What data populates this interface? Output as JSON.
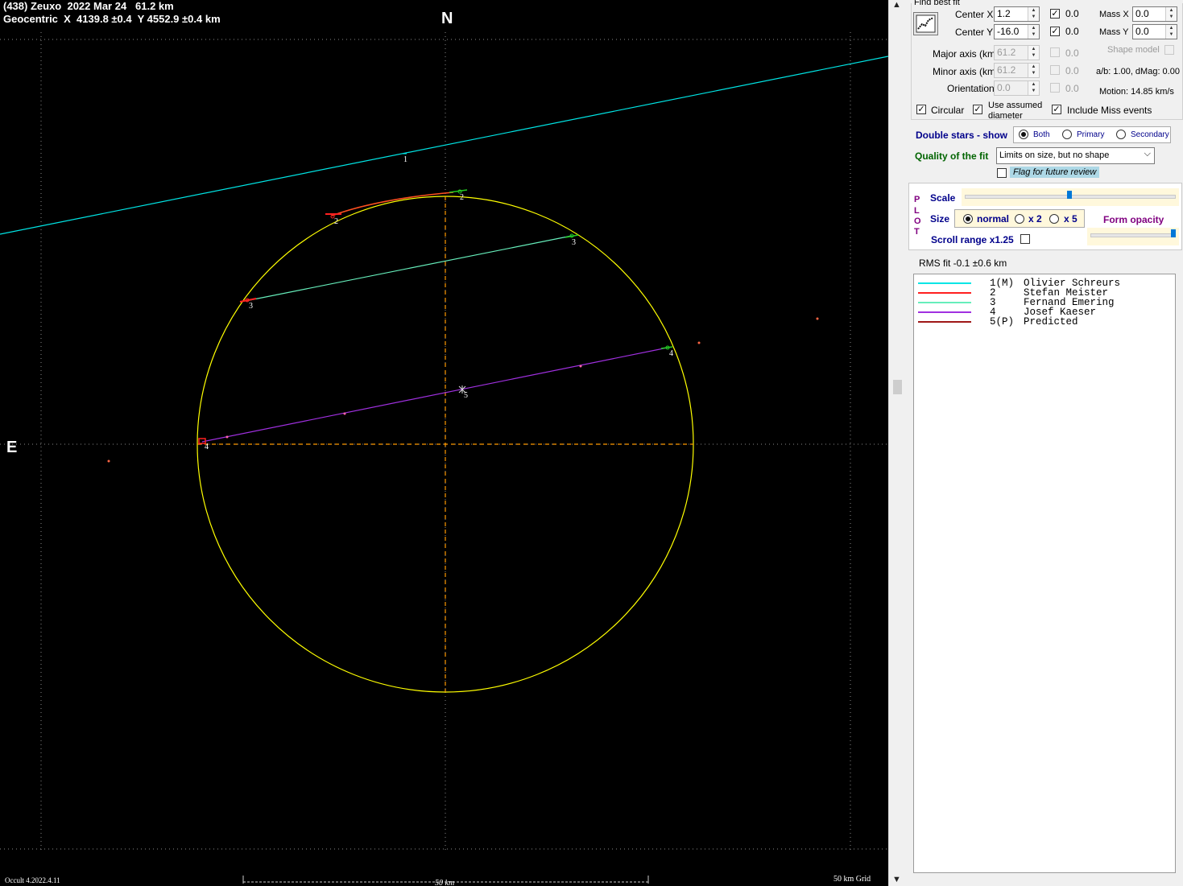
{
  "plot": {
    "header_line1": "(438) Zeuxo  2022 Mar 24   61.2 km",
    "header_line2": "Geocentric  X  4139.8 ±0.4  Y 4552.9 ±0.4 km",
    "north_label": "N",
    "east_label": "E",
    "version": "Occult 4.2022.4.11",
    "scale_label": "50 km",
    "grid_label": "50 km Grid",
    "chord_labels": [
      "1",
      "2",
      "3",
      "3",
      "4",
      "4",
      "5",
      "2"
    ],
    "colors": {
      "ellipse": "#ffff00",
      "axis": "#ff9900",
      "chord1": "#00e5e5",
      "chord3": "#66eebb",
      "chord4": "#a030e0",
      "chord2": "#ff2020"
    }
  },
  "panel": {
    "find_best_fit": "Find best fit",
    "center_x_label": "Center X",
    "center_x_value": "1.2",
    "center_y_label": "Center Y",
    "center_y_value": "-16.0",
    "cx_check_label": "0.0",
    "cy_check_label": "0.0",
    "mass_x_label": "Mass X",
    "mass_x_value": "0.0",
    "mass_y_label": "Mass Y",
    "mass_y_value": "0.0",
    "shape_model_label": "Shape model",
    "major_axis_label": "Major axis (km)",
    "major_axis_value": "61.2",
    "minor_axis_label": "Minor axis (km)",
    "minor_axis_value": "61.2",
    "orientation_label": "Orientation",
    "orientation_value": "0.0",
    "major_check_label": "0.0",
    "minor_check_label": "0.0",
    "orient_check_label": "0.0",
    "ab_text": "a/b: 1.00, dMag: 0.00",
    "motion_text": "Motion: 14.85 km/s",
    "circular_label": "Circular",
    "use_assumed_label_1": "Use assumed",
    "use_assumed_label_2": "diameter",
    "include_miss_label": "Include Miss events",
    "double_stars_label": "Double stars - show",
    "ds_both": "Both",
    "ds_primary": "Primary",
    "ds_secondary": "Secondary",
    "quality_label": "Quality of the fit",
    "quality_value": "Limits on size, but no shape",
    "flag_label": "Flag for future review",
    "plot_letters": [
      "P",
      "L",
      "O",
      "T"
    ],
    "scale_label": "Scale",
    "size_label": "Size",
    "size_normal": "normal",
    "size_x2": "x 2",
    "size_x5": "x 5",
    "form_opacity_label": "Form opacity",
    "scroll_range_label": "Scroll range x1.25",
    "rms_text": "RMS fit -0.1 ±0.6 km",
    "scale_slider_fraction": 0.5,
    "opacity_slider_fraction": 1.0
  },
  "legend": [
    {
      "num": "1",
      "tag": "(M)",
      "name": "Olivier Schreurs",
      "color": "#00e5e5"
    },
    {
      "num": "2",
      "tag": "",
      "name": "Stefan Meister",
      "color": "#ff2020"
    },
    {
      "num": "3",
      "tag": "",
      "name": "Fernand Emering",
      "color": "#66eebb"
    },
    {
      "num": "4",
      "tag": "",
      "name": "Josef Kaeser",
      "color": "#a030e0"
    },
    {
      "num": "5",
      "tag": "(P)",
      "name": "Predicted",
      "color": "#a01818"
    }
  ]
}
